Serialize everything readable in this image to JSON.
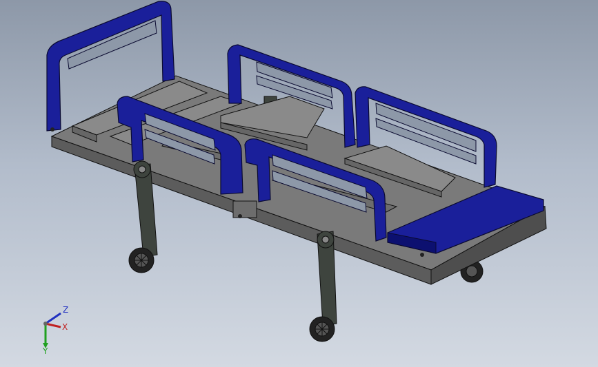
{
  "viewport": {
    "background_top": "#8d98a8",
    "background_bottom": "#d3d9e2"
  },
  "model": {
    "frame_color": "#666666",
    "frame_top_color": "#7a7a7a",
    "frame_side_color": "#555555",
    "rail_color": "#1a1f9a",
    "rail_dark_color": "#0c1070",
    "leg_color": "#3e443e",
    "wheel_color": "#222222",
    "edge_color": "#111111"
  },
  "triad": {
    "z_label": "Z",
    "x_label": "X",
    "y_label": "Y",
    "z_color": "#2030c0",
    "x_color": "#c02020",
    "y_color": "#20a020"
  }
}
